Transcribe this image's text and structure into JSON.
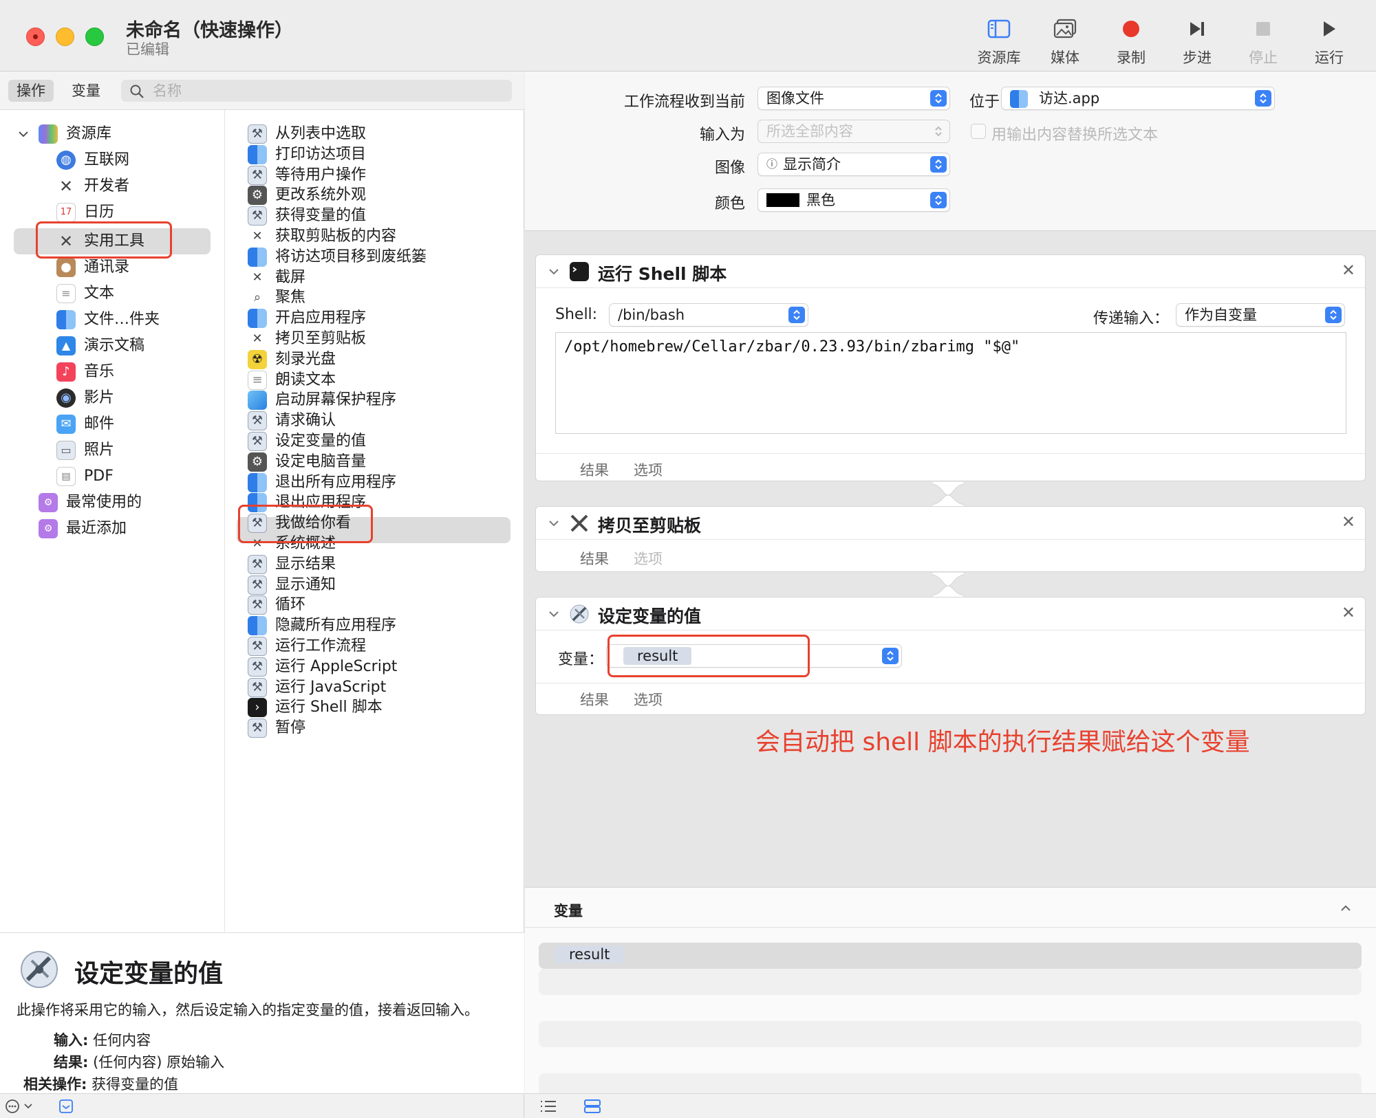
{
  "window": {
    "title": "未命名（快速操作）",
    "subtitle": "已编辑",
    "toolbar": [
      {
        "label": "资源库",
        "icon": "library-icon",
        "enabled": true
      },
      {
        "label": "媒体",
        "icon": "media-icon",
        "enabled": true
      },
      {
        "label": "录制",
        "icon": "record-icon",
        "enabled": true
      },
      {
        "label": "步进",
        "icon": "step-icon",
        "enabled": true
      },
      {
        "label": "停止",
        "icon": "stop-icon",
        "enabled": false
      },
      {
        "label": "运行",
        "icon": "run-icon",
        "enabled": true
      }
    ]
  },
  "left": {
    "segments": [
      "操作",
      "变量"
    ],
    "active_segment": "操作",
    "search_placeholder": "名称",
    "library": {
      "root": "资源库",
      "items": [
        {
          "label": "互联网",
          "icon": "globe-icon"
        },
        {
          "label": "开发者",
          "icon": "tools-icon"
        },
        {
          "label": "日历",
          "icon": "calendar-icon"
        },
        {
          "label": "实用工具",
          "icon": "tools-icon",
          "selected": true
        },
        {
          "label": "通讯录",
          "icon": "contacts-icon"
        },
        {
          "label": "文本",
          "icon": "text-icon"
        },
        {
          "label": "文件…件夹",
          "icon": "finder-icon"
        },
        {
          "label": "演示文稿",
          "icon": "keynote-icon"
        },
        {
          "label": "音乐",
          "icon": "music-icon"
        },
        {
          "label": "影片",
          "icon": "movie-icon"
        },
        {
          "label": "邮件",
          "icon": "mail-icon"
        },
        {
          "label": "照片",
          "icon": "photos-icon"
        },
        {
          "label": "PDF",
          "icon": "pdf-icon"
        }
      ],
      "smart_groups": [
        {
          "label": "最常使用的",
          "icon": "folder-icon"
        },
        {
          "label": "最近添加",
          "icon": "folder-icon"
        }
      ]
    },
    "actions": [
      {
        "label": "从列表中选取",
        "icon": "automator-icon"
      },
      {
        "label": "打印访达项目",
        "icon": "finder-icon"
      },
      {
        "label": "等待用户操作",
        "icon": "automator-icon"
      },
      {
        "label": "更改系统外观",
        "icon": "settings-icon"
      },
      {
        "label": "获得变量的值",
        "icon": "automator-icon"
      },
      {
        "label": "获取剪贴板的内容",
        "icon": "tools-icon"
      },
      {
        "label": "将访达项目移到废纸篓",
        "icon": "finder-icon"
      },
      {
        "label": "截屏",
        "icon": "tools-icon"
      },
      {
        "label": "聚焦",
        "icon": "spotlight-icon"
      },
      {
        "label": "开启应用程序",
        "icon": "finder-icon"
      },
      {
        "label": "拷贝至剪贴板",
        "icon": "tools-icon"
      },
      {
        "label": "刻录光盘",
        "icon": "burn-icon"
      },
      {
        "label": "朗读文本",
        "icon": "text-icon"
      },
      {
        "label": "启动屏幕保护程序",
        "icon": "screensaver-icon"
      },
      {
        "label": "请求确认",
        "icon": "automator-icon"
      },
      {
        "label": "设定变量的值",
        "icon": "automator-icon",
        "selected": true
      },
      {
        "label": "设定电脑音量",
        "icon": "settings-icon"
      },
      {
        "label": "退出所有应用程序",
        "icon": "finder-icon"
      },
      {
        "label": "退出应用程序",
        "icon": "finder-icon"
      },
      {
        "label": "我做给你看",
        "icon": "automator-icon"
      },
      {
        "label": "系统概述",
        "icon": "tools-icon"
      },
      {
        "label": "显示结果",
        "icon": "automator-icon"
      },
      {
        "label": "显示通知",
        "icon": "automator-icon"
      },
      {
        "label": "循环",
        "icon": "automator-icon"
      },
      {
        "label": "隐藏所有应用程序",
        "icon": "finder-icon"
      },
      {
        "label": "运行工作流程",
        "icon": "automator-icon"
      },
      {
        "label": "运行 AppleScript",
        "icon": "automator-icon"
      },
      {
        "label": "运行 JavaScript",
        "icon": "automator-icon"
      },
      {
        "label": "运行 Shell 脚本",
        "icon": "terminal-icon"
      },
      {
        "label": "暂停",
        "icon": "automator-icon"
      }
    ],
    "description": {
      "title": "设定变量的值",
      "text": "此操作将采用它的输入，然后设定输入的指定变量的值，接着返回输入。",
      "input_key": "输入:",
      "input_value": "任何内容",
      "result_key": "结果:",
      "result_value": "(任何内容) 原始输入",
      "related_key": "相关操作:",
      "related_value": "获得变量的值"
    }
  },
  "workflow": {
    "receives_label": "工作流程收到当前",
    "receives_value": "图像文件",
    "in_label": "位于",
    "in_value": "访达.app",
    "input_is_label": "输入为",
    "input_is_value": "所选全部内容",
    "replace_label": "用输出内容替换所选文本",
    "image_label": "图像",
    "image_value": "显示简介",
    "color_label": "颜色",
    "color_value": "黑色",
    "color_swatch": "#000000"
  },
  "actions_flow": {
    "shell": {
      "title": "运行 Shell 脚本",
      "shell_label": "Shell:",
      "shell_value": "/bin/bash",
      "pass_label": "传递输入：",
      "pass_value": "作为自变量",
      "script": "/opt/homebrew/Cellar/zbar/0.23.93/bin/zbarimg \"$@\"",
      "tab_results": "结果",
      "tab_options": "选项"
    },
    "copy": {
      "title": "拷贝至剪贴板",
      "tab_results": "结果",
      "tab_options": "选项"
    },
    "setvar": {
      "title": "设定变量的值",
      "var_label": "变量：",
      "var_value": "result",
      "tab_results": "结果",
      "tab_options": "选项"
    }
  },
  "annotation": "会自动把 shell 脚本的执行结果赋给这个变量",
  "variables_panel": {
    "title": "变量",
    "items": [
      "result"
    ]
  },
  "colors": {
    "accent": "#3b82f6",
    "highlight_box": "#e8412e",
    "record": "#e8372b"
  }
}
